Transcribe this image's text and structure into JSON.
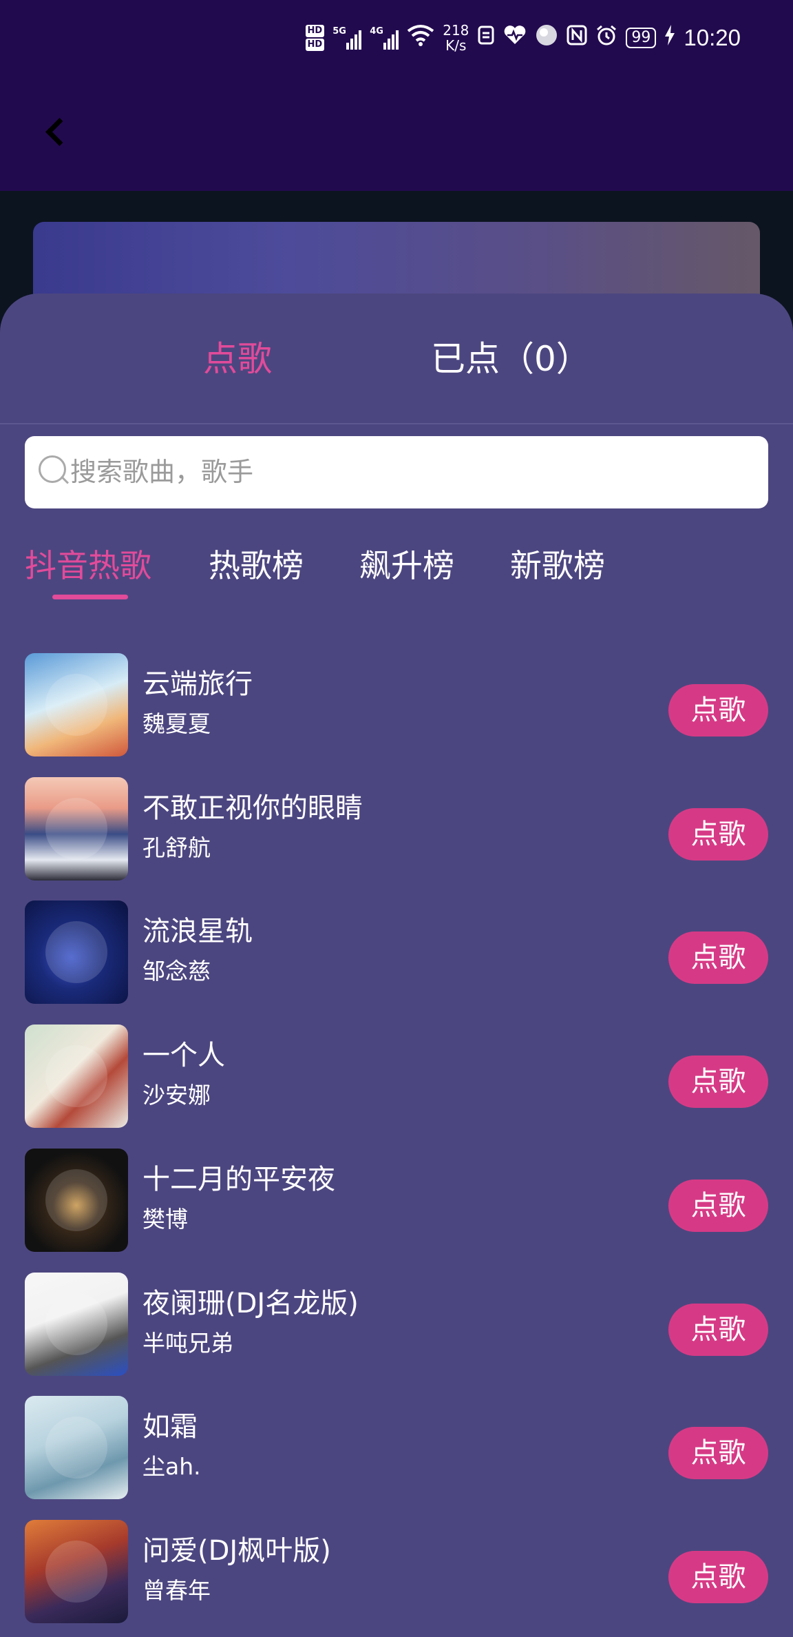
{
  "status_bar": {
    "hd1": "HD",
    "hd2": "HD",
    "sig1_gen": "5G",
    "sig2_gen": "4G",
    "speed_value": "218",
    "speed_unit": "K/s",
    "battery": "99",
    "time": "10:20"
  },
  "tabs": {
    "request": "点歌",
    "requested": "已点（0）"
  },
  "search": {
    "placeholder": "搜索歌曲，歌手"
  },
  "categories": [
    "抖音热歌",
    "热歌榜",
    "飙升榜",
    "新歌榜"
  ],
  "songs": [
    {
      "title": "云端旅行",
      "artist": "魏夏夏",
      "button": "点歌"
    },
    {
      "title": "不敢正视你的眼睛",
      "artist": "孔舒航",
      "button": "点歌"
    },
    {
      "title": "流浪星轨",
      "artist": "邹念慈",
      "button": "点歌"
    },
    {
      "title": "一个人",
      "artist": "沙安娜",
      "button": "点歌"
    },
    {
      "title": "十二月的平安夜",
      "artist": "樊博",
      "button": "点歌"
    },
    {
      "title": "夜阑珊(DJ名龙版)",
      "artist": "半吨兄弟",
      "button": "点歌"
    },
    {
      "title": "如霜",
      "artist": "尘ah.",
      "button": "点歌"
    },
    {
      "title": "问爱(DJ枫叶版)",
      "artist": "曾春年",
      "button": "点歌"
    }
  ],
  "colors": {
    "accent": "#e24b9a",
    "button": "#d63a86",
    "panel": "#4c4680",
    "header": "#220a4f"
  }
}
